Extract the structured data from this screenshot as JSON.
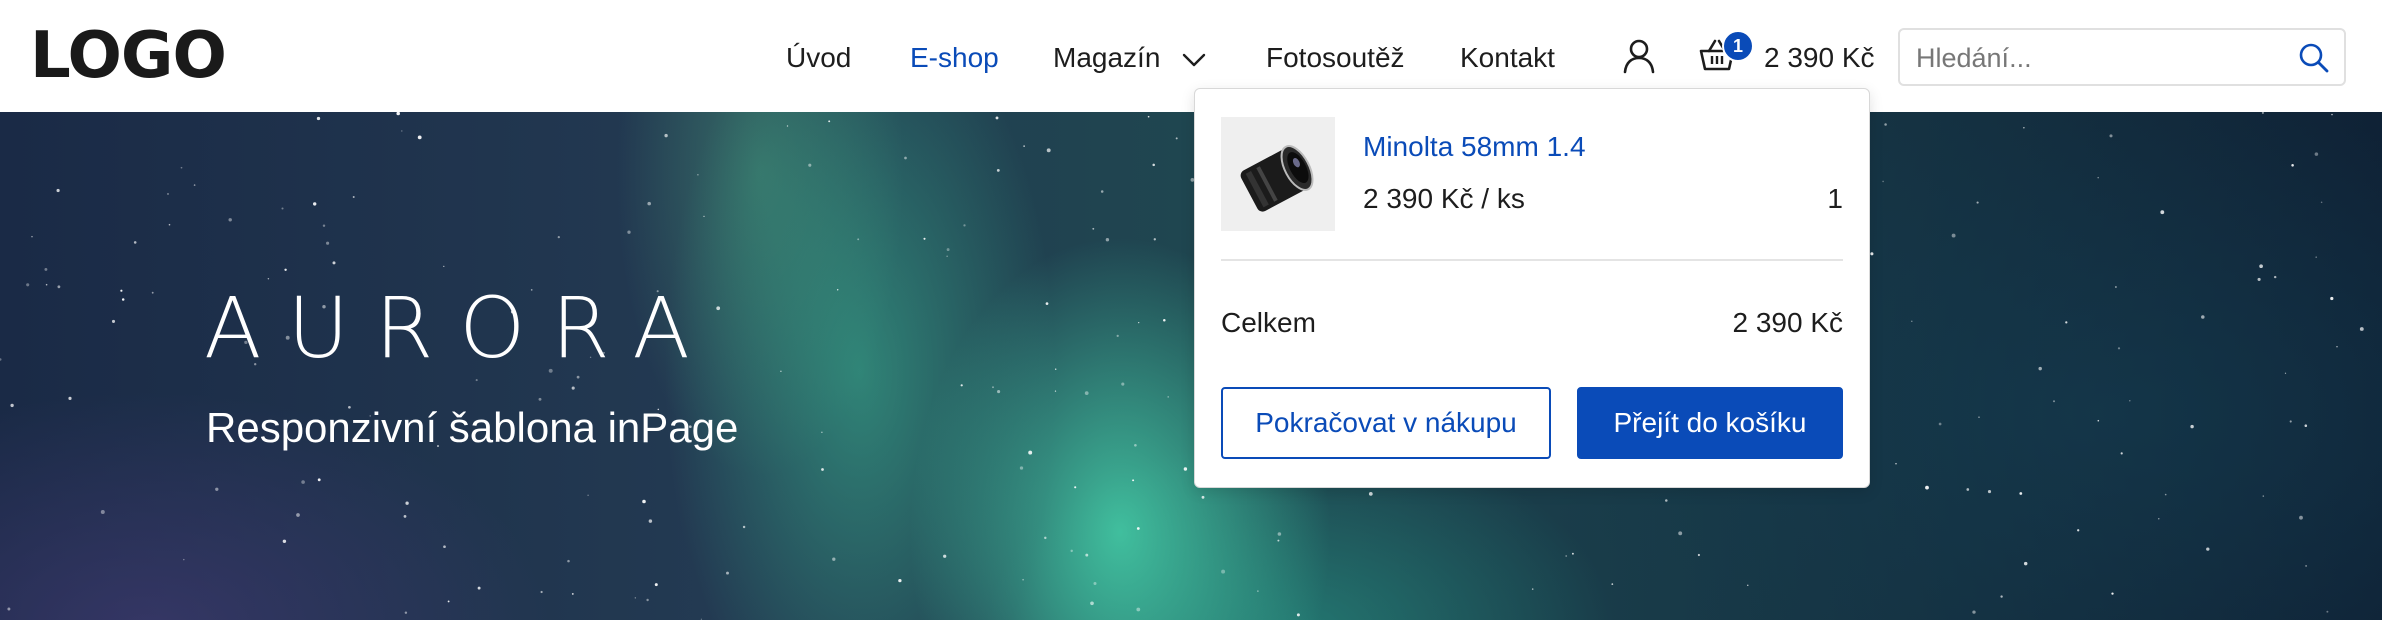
{
  "header": {
    "logo": "LOGO",
    "nav": [
      {
        "label": "Úvod",
        "active": false
      },
      {
        "label": "E-shop",
        "active": true
      },
      {
        "label": "Magazín",
        "active": false,
        "has_dropdown": true
      },
      {
        "label": "Fotosoutěž",
        "active": false
      },
      {
        "label": "Kontakt",
        "active": false
      }
    ],
    "cart": {
      "count": "1",
      "total": "2 390 Kč",
      "icon": "basket-icon"
    },
    "user_icon": "user-icon",
    "search": {
      "placeholder": "Hledání...",
      "icon": "search-icon"
    }
  },
  "hero": {
    "title": "AURORA",
    "subtitle": "Responzivní šablona inPage"
  },
  "cart_popup": {
    "items": [
      {
        "name": "Minolta 58mm 1.4",
        "price": "2 390 Kč / ks",
        "quantity": "1"
      }
    ],
    "total_label": "Celkem",
    "total_value": "2 390 Kč",
    "continue_label": "Pokračovat v nákupu",
    "checkout_label": "Přejít do košíku"
  },
  "colors": {
    "accent": "#0a4bb8",
    "text": "#1d1d1d",
    "header_bg": "#ffffff"
  }
}
